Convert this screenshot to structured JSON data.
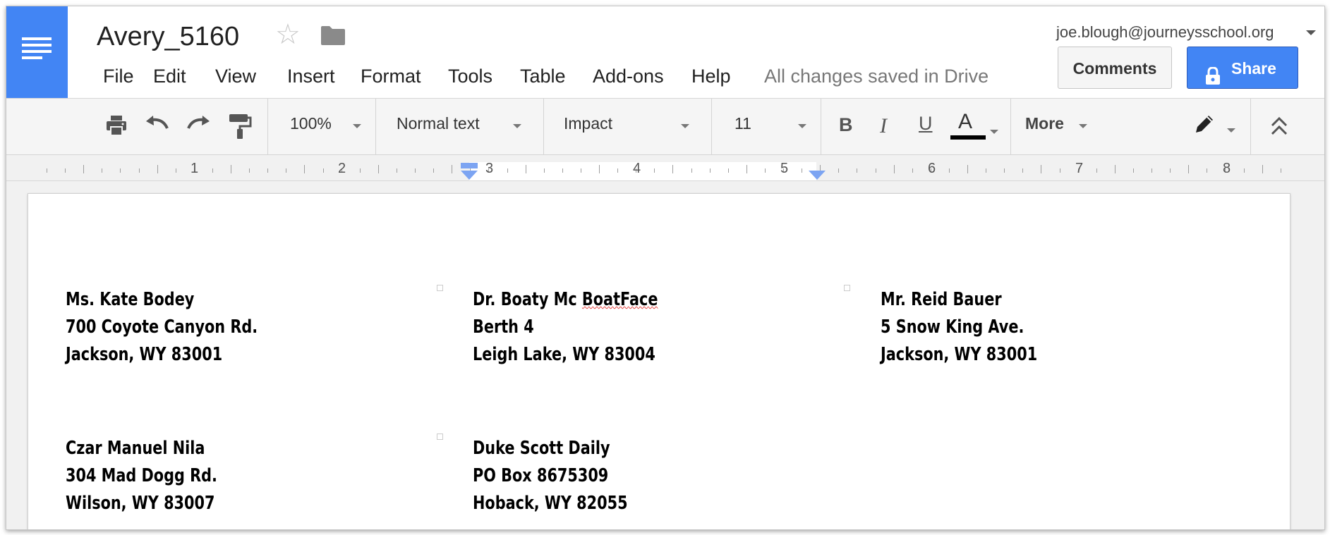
{
  "app": {
    "title": "Avery_5160",
    "account": "joe.blough@journeysschool.org",
    "save_status": "All changes saved in Drive"
  },
  "menu": [
    "File",
    "Edit",
    "View",
    "Insert",
    "Format",
    "Tools",
    "Table",
    "Add-ons",
    "Help"
  ],
  "buttons": {
    "comments": "Comments",
    "share": "Share"
  },
  "toolbar": {
    "zoom": "100%",
    "style": "Normal text",
    "font": "Impact",
    "size": "11",
    "text_color_glyph": "A",
    "more": "More"
  },
  "ruler": {
    "numbers": [
      "1",
      "2",
      "3",
      "4",
      "5",
      "6",
      "7",
      "8"
    ]
  },
  "labels": [
    {
      "name": "Ms. Kate Bodey",
      "street": "700 Coyote Canyon Rd.",
      "city": "Jackson, WY  83001"
    },
    {
      "name_a": "Dr. Boaty Mc ",
      "name_b": "BoatFace",
      "street": "Berth 4",
      "city": "Leigh Lake, WY  83004"
    },
    {
      "name": "Mr. Reid Bauer",
      "street": "5 Snow King Ave.",
      "city": "Jackson, WY  83001"
    },
    {
      "name": "Czar Manuel Nila",
      "street": "304 Mad Dogg Rd.",
      "city": "Wilson, WY  83007"
    },
    {
      "name": "Duke Scott Daily",
      "street": "PO Box 8675309",
      "city": "Hoback, WY  82055"
    }
  ],
  "icons": {
    "app": "docs-menu-icon",
    "star": "star-icon",
    "folder": "folder-icon",
    "print": "print-icon",
    "undo": "undo-icon",
    "redo": "redo-icon",
    "paint": "paint-format-icon",
    "bold": "bold-icon",
    "italic": "italic-icon",
    "underline": "underline-icon",
    "pencil": "editing-mode-icon",
    "collapse": "collapse-icon",
    "lock": "lock-icon"
  },
  "colors": {
    "brand": "#4285f4",
    "share_bg": "#4285f4",
    "text_color_bar": "#000000"
  }
}
